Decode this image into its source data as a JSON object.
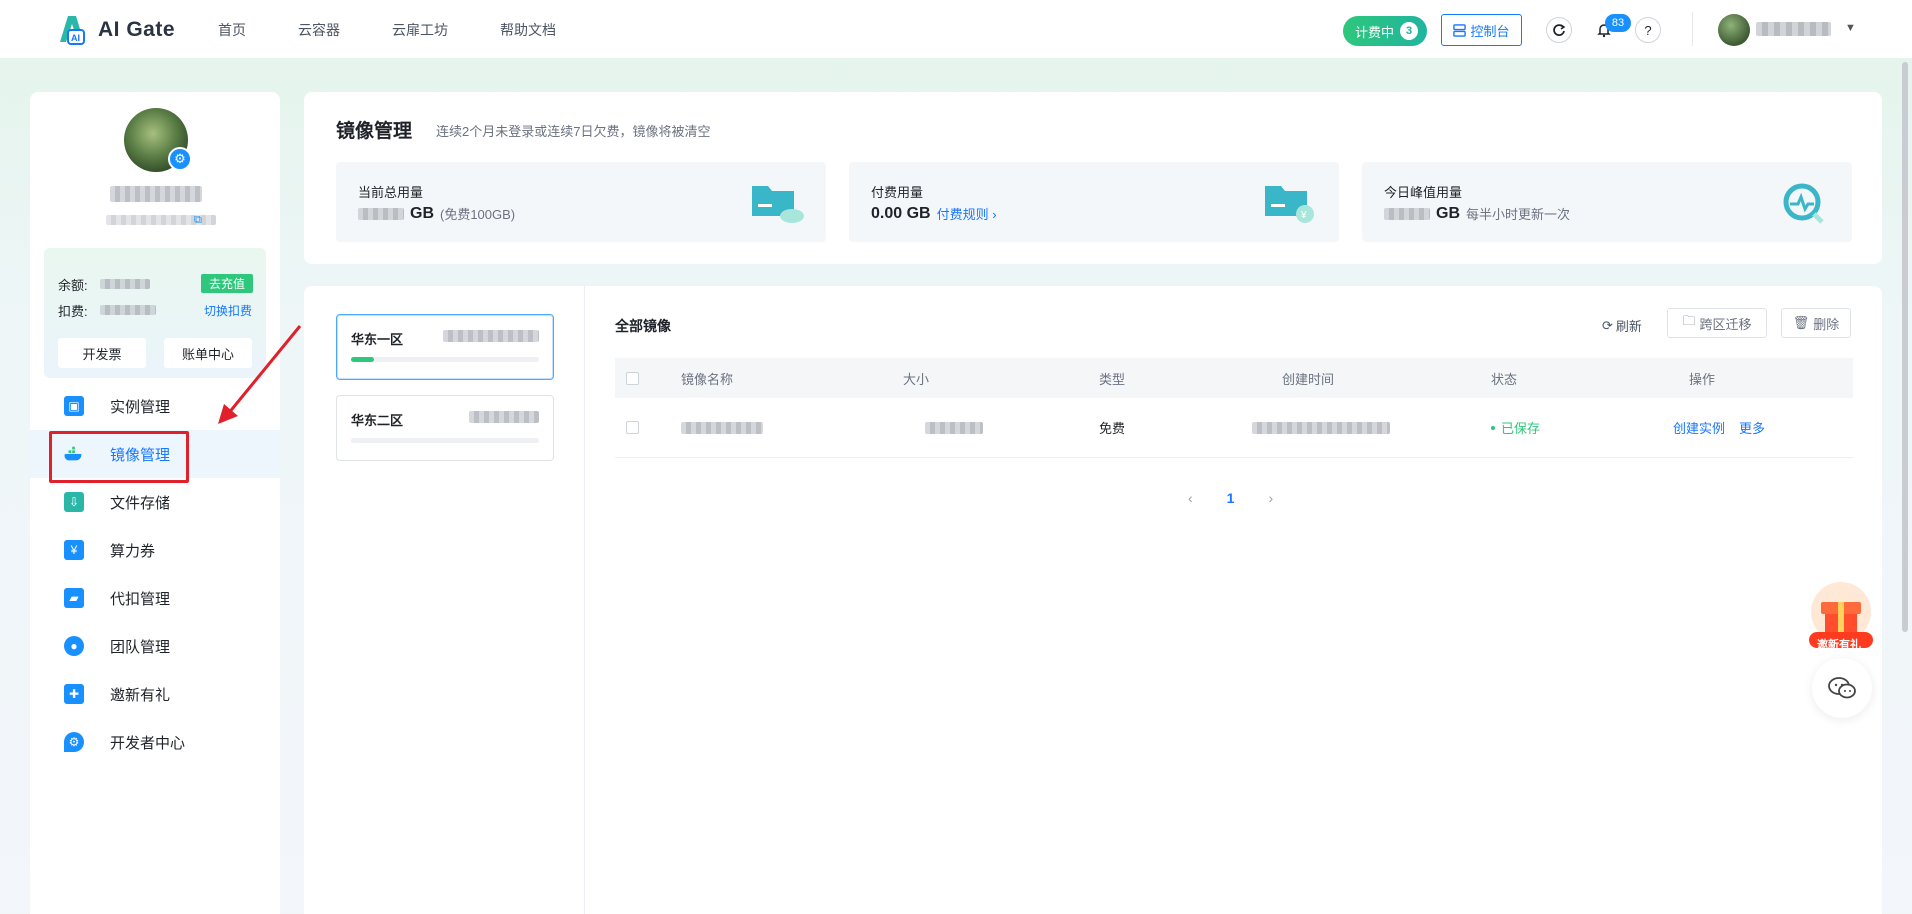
{
  "app": {
    "logo_text": "AI Gate"
  },
  "nav": {
    "items": [
      "首页",
      "云容器",
      "云扉工坊",
      "帮助文档"
    ]
  },
  "topbar": {
    "billing_label": "计费中",
    "billing_count": "3",
    "console_label": "控制台",
    "notify_count": "83",
    "help_glyph": "?"
  },
  "sidebar": {
    "balance_label": "余额:",
    "deduct_label": "扣费:",
    "recharge_label": "去充值",
    "switch_label": "切换扣费",
    "invoice_label": "开发票",
    "bill_center_label": "账单中心",
    "menu": [
      {
        "label": "实例管理",
        "icon": "instance-icon"
      },
      {
        "label": "镜像管理",
        "icon": "image-icon"
      },
      {
        "label": "文件存储",
        "icon": "storage-icon"
      },
      {
        "label": "算力券",
        "icon": "coupon-icon"
      },
      {
        "label": "代扣管理",
        "icon": "wallet-icon"
      },
      {
        "label": "团队管理",
        "icon": "team-icon"
      },
      {
        "label": "邀新有礼",
        "icon": "gift-icon"
      },
      {
        "label": "开发者中心",
        "icon": "developer-icon"
      }
    ]
  },
  "header": {
    "title": "镜像管理",
    "note": "连续2个月未登录或连续7日欠费，镜像将被清空",
    "stats": [
      {
        "label": "当前总用量",
        "unit": "GB",
        "sub": "(免费100GB)",
        "value": ""
      },
      {
        "label": "付费用量",
        "unit": "",
        "value": "0.00 GB",
        "link": "付费规则 ›"
      },
      {
        "label": "今日峰值用量",
        "unit": "GB",
        "sub": "每半小时更新一次",
        "value": ""
      }
    ]
  },
  "regions": [
    {
      "name": "华东一区",
      "usage_fraction": 0.12
    },
    {
      "name": "华东二区",
      "usage_fraction": 0.0
    }
  ],
  "image_list": {
    "title": "全部镜像",
    "refresh_label": "刷新",
    "migrate_label": "跨区迁移",
    "delete_label": "删除",
    "columns": [
      "镜像名称",
      "大小",
      "类型",
      "创建时间",
      "状态",
      "操作"
    ],
    "rows": [
      {
        "type": "免费",
        "status": "已保存",
        "action_create": "创建实例",
        "action_more": "更多"
      }
    ],
    "pagination": {
      "prev": "‹",
      "current": "1",
      "next": "›"
    }
  },
  "floating": {
    "invite_label": "邀新有礼"
  },
  "colors": {
    "accent": "#1677ff",
    "success": "#2ec77b",
    "highlight": "#e0202a"
  }
}
